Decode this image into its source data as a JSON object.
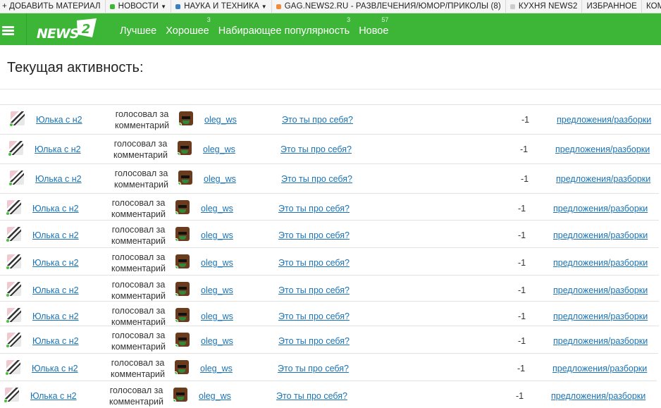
{
  "topbar": {
    "items": [
      {
        "label": "+ ДОБАВИТЬ МАТЕРИАЛ",
        "dot_color": "",
        "dropdown": false
      },
      {
        "label": "НОВОСТИ",
        "dot_color": "#3db638",
        "dropdown": true
      },
      {
        "label": "НАУКА И ТЕХНИКА",
        "dot_color": "#3b7fc4",
        "dropdown": true
      },
      {
        "label": "GAG.NEWS2.RU - РАЗВЛЕЧЕНИЯ/ЮМОР/ПРИКОЛЫ (8)",
        "dot_color": "#f08a3c",
        "dropdown": false
      },
      {
        "label": "КУХНЯ NEWS2",
        "dot_color": "#cccccc",
        "dropdown": false
      },
      {
        "label": "ИЗБРАННОЕ",
        "dot_color": "",
        "dropdown": false
      },
      {
        "label": "КОММЕНТАРИИ",
        "dot_color": "",
        "dropdown": false
      }
    ]
  },
  "header": {
    "logo_text": "NEWS",
    "logo_mark": "2",
    "nav": [
      {
        "label": "Лучшее",
        "count": ""
      },
      {
        "label": "Хорошее",
        "count": "3"
      },
      {
        "label": "Набирающее популярность",
        "count": "3"
      },
      {
        "label": "Новое",
        "count": "57"
      }
    ]
  },
  "page": {
    "title": "Текущая активность:"
  },
  "activity": [
    {
      "user": "Юлька с н2",
      "action": "голосовал за комментарий",
      "target_user": "oleg_ws",
      "post": "Это ты про себя?",
      "score": "-1",
      "category": "предложения/разборки"
    },
    {
      "user": "Юлька с н2",
      "action": "голосовал за комментарий",
      "target_user": "oleg_ws",
      "post": "Это ты про себя?",
      "score": "-1",
      "category": "предложения/разборки"
    },
    {
      "user": "Юлька с н2",
      "action": "голосовал за комментарий",
      "target_user": "oleg_ws",
      "post": "Это ты про себя?",
      "score": "-1",
      "category": "предложения/разборки"
    },
    {
      "user": "Юлька с н2",
      "action": "голосовал за комментарий",
      "target_user": "oleg_ws",
      "post": "Это ты про себя?",
      "score": "-1",
      "category": "предложения/разборки"
    },
    {
      "user": "Юлька с н2",
      "action": "голосовал за комментарий",
      "target_user": "oleg_ws",
      "post": "Это ты про себя?",
      "score": "-1",
      "category": "предложения/разборки"
    },
    {
      "user": "Юлька с н2",
      "action": "голосовал за комментарий",
      "target_user": "oleg_ws",
      "post": "Это ты про себя?",
      "score": "-1",
      "category": "предложения/разборки"
    },
    {
      "user": "Юлька с н2",
      "action": "голосовал за комментарий",
      "target_user": "oleg_ws",
      "post": "Это ты про себя?",
      "score": "-1",
      "category": "предложения/разборки"
    },
    {
      "user": "Юлька с н2",
      "action": "голосовал за комментарий",
      "target_user": "oleg_ws",
      "post": "Это ты про себя?",
      "score": "-1",
      "category": "предложения/разборки"
    },
    {
      "user": "Юлька с н2",
      "action": "голосовал за комментарий",
      "target_user": "oleg_ws",
      "post": "Это ты про себя?",
      "score": "-1",
      "category": "предложения/разборки"
    },
    {
      "user": "Юлька с н2",
      "action": "голосовал за комментарий",
      "target_user": "oleg_ws",
      "post": "Это ты про себя?",
      "score": "-1",
      "category": "предложения/разборки"
    },
    {
      "user": "Юлька с н2",
      "action": "голосовал за комментарий",
      "target_user": "oleg_ws",
      "post": "Это ты про себя?",
      "score": "-1",
      "category": "предложения/разборки"
    }
  ]
}
